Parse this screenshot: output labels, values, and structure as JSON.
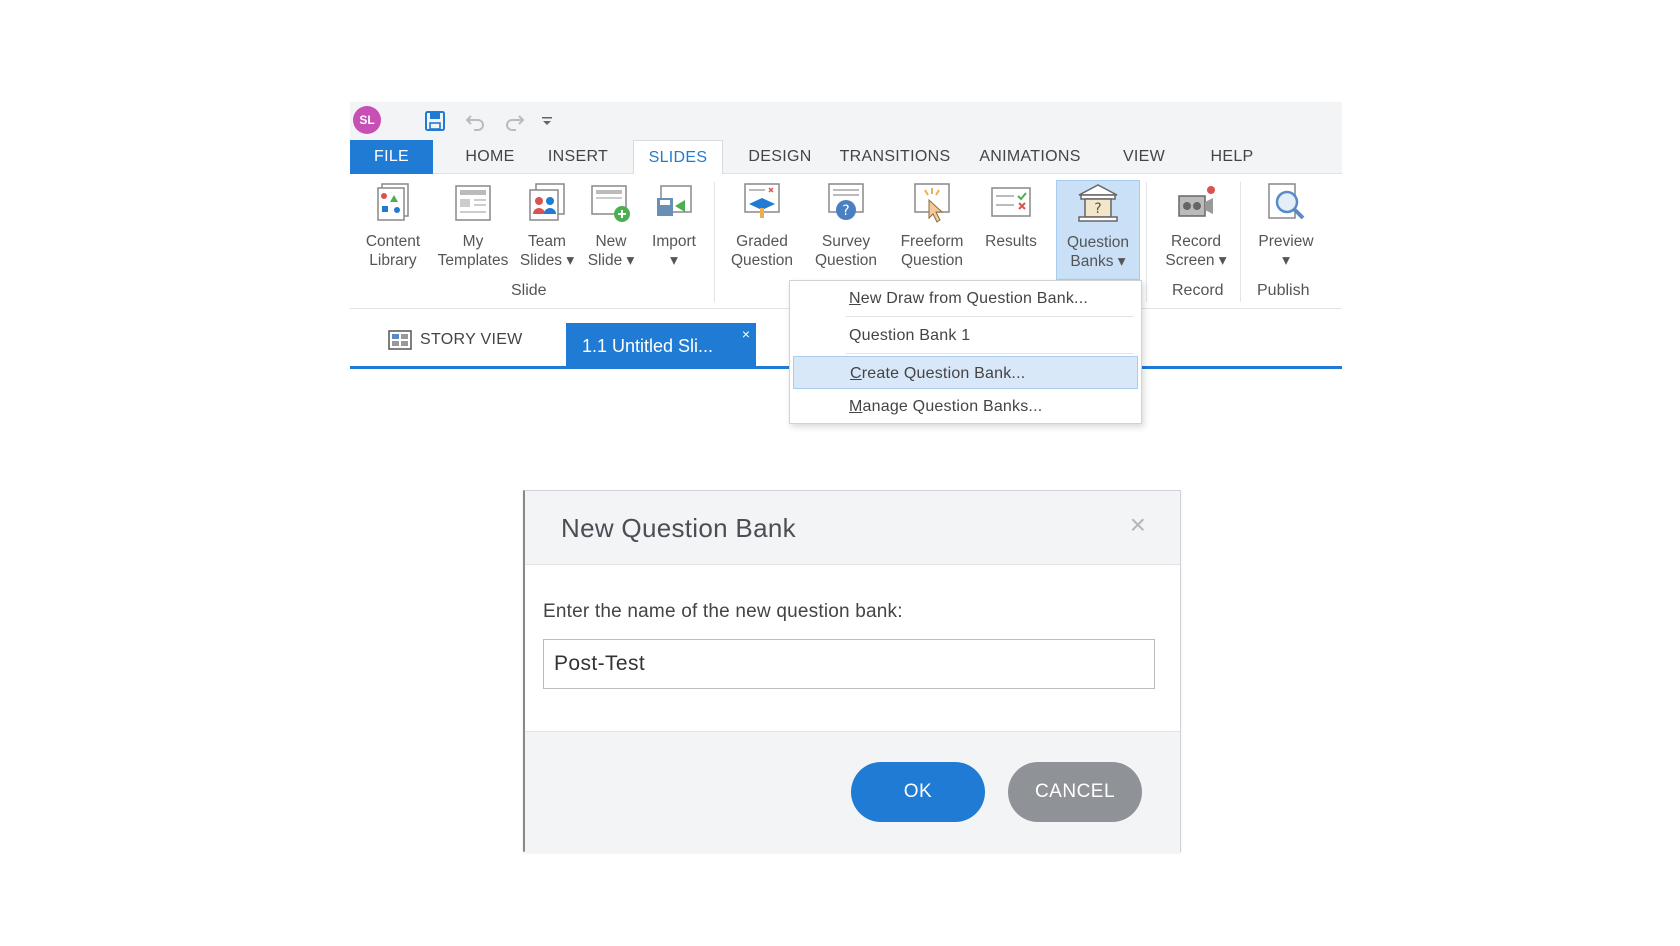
{
  "app": {
    "logo_text": "SL",
    "qat": {
      "icons": [
        "save-icon",
        "undo-icon",
        "redo-icon",
        "customize-icon"
      ]
    },
    "tabs": [
      "FILE",
      "HOME",
      "INSERT",
      "SLIDES",
      "DESIGN",
      "TRANSITIONS",
      "ANIMATIONS",
      "VIEW",
      "HELP"
    ],
    "active_tab": "SLIDES",
    "ribbon": {
      "buttons": [
        {
          "line1": "Content",
          "line2": "Library"
        },
        {
          "line1": "My",
          "line2": "Templates"
        },
        {
          "line1": "Team",
          "line2": "Slides ▾"
        },
        {
          "line1": "New",
          "line2": "Slide ▾"
        },
        {
          "line1": "Import",
          "line2": "▾"
        },
        {
          "line1": "Graded",
          "line2": "Question"
        },
        {
          "line1": "Survey",
          "line2": "Question"
        },
        {
          "line1": "Freeform",
          "line2": "Question"
        },
        {
          "line1": "Results",
          "line2": ""
        },
        {
          "line1": "Question",
          "line2": "Banks ▾"
        },
        {
          "line1": "Record",
          "line2": "Screen ▾"
        },
        {
          "line1": "Preview",
          "line2": "▾"
        }
      ],
      "groups": {
        "slide": "Slide",
        "record": "Record",
        "publish": "Publish"
      }
    },
    "story_view_label": "STORY VIEW",
    "slide_tab_label": "1.1 Untitled Sli...",
    "close_glyph": "×"
  },
  "menu": {
    "items": [
      {
        "pre": "",
        "u": "N",
        "post": "ew Draw from Question Bank..."
      },
      {
        "pre": "",
        "u": "",
        "post": "Question Bank 1"
      },
      {
        "pre": "",
        "u": "C",
        "post": "reate Question Bank..."
      },
      {
        "pre": "",
        "u": "M",
        "post": "anage Question Banks..."
      }
    ],
    "selected_index": 2
  },
  "dialog": {
    "title": "New Question Bank",
    "close_glyph": "×",
    "prompt": "Enter the name of the new question bank:",
    "input_value": "Post-Test",
    "ok_label": "OK",
    "cancel_label": "CANCEL"
  },
  "colors": {
    "accent": "#1f7bd4",
    "cancel": "#8f9397",
    "highlight": "#c9e0f7"
  }
}
